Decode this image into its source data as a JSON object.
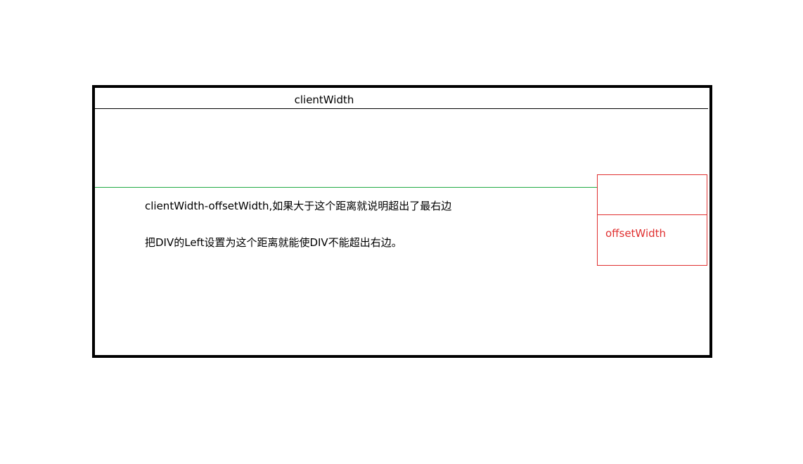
{
  "diagram": {
    "client_width_label": "clientWidth",
    "offset_width_label": "offsetWidth",
    "explanation_line_1": "clientWidth-offsetWidth,如果大于这个距离就说明超出了最右边",
    "explanation_line_2": "把DIV的Left设置为这个距离就能使DIV不能超出右边。"
  },
  "colors": {
    "outer_border": "#000000",
    "green_line": "#22aa44",
    "red_box": "#e03030",
    "offset_text": "#e03030"
  }
}
